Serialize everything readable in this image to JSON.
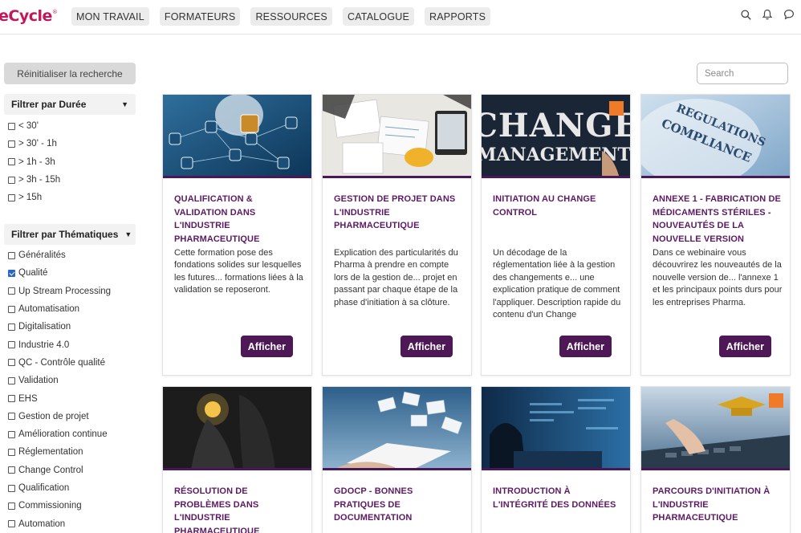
{
  "header": {
    "logo": "eCycle",
    "logo_mark": "®",
    "nav": [
      "MON TRAVAIL",
      "FORMATEURS",
      "RESSOURCES",
      "CATALOGUE",
      "RAPPORTS"
    ],
    "icons": [
      "search-icon",
      "bell-icon",
      "chat-icon"
    ]
  },
  "sidebar": {
    "reset_label": "Réinitialiser la recherche",
    "duration": {
      "title": "Filtrer par Durée",
      "options": [
        {
          "label": "< 30'",
          "checked": false
        },
        {
          "label": "> 30' - 1h",
          "checked": false
        },
        {
          "label": "> 1h - 3h",
          "checked": false
        },
        {
          "label": "> 3h - 15h",
          "checked": false
        },
        {
          "label": "> 15h",
          "checked": false
        }
      ]
    },
    "theme": {
      "title": "Filtrer par Thématiques",
      "options": [
        {
          "label": "Généralités",
          "checked": false
        },
        {
          "label": "Qualité",
          "checked": true
        },
        {
          "label": "Up Stream Processing",
          "checked": false
        },
        {
          "label": "Automatisation",
          "checked": false
        },
        {
          "label": "Digitalisation",
          "checked": false
        },
        {
          "label": "Industrie 4.0",
          "checked": false
        },
        {
          "label": "QC - Contrôle qualité",
          "checked": false
        },
        {
          "label": "Validation",
          "checked": false
        },
        {
          "label": "EHS",
          "checked": false
        },
        {
          "label": "Gestion de projet",
          "checked": false
        },
        {
          "label": "Amélioration continue",
          "checked": false
        },
        {
          "label": "Réglementation",
          "checked": false
        },
        {
          "label": "Change Control",
          "checked": false
        },
        {
          "label": "Qualification",
          "checked": false
        },
        {
          "label": "Commissioning",
          "checked": false
        },
        {
          "label": "Automation",
          "checked": false
        }
      ]
    }
  },
  "search": {
    "placeholder": "Search"
  },
  "cards": [
    {
      "title": "QUALIFICATION & VALIDATION DANS L'INDUSTRIE PHARMACEUTIQUE",
      "desc": "Cette formation pose des fondations solides sur lesquelles les futures... formations liées à la validation se reposeront.",
      "button": "Afficher",
      "thumb_text": ""
    },
    {
      "title": "GESTION DE PROJET DANS L'INDUSTRIE PHARMACEUTIQUE",
      "desc": "Explication des particularités du Pharma à prendre en compte lors de la gestion de... projet en passant par chaque étape de la phase d'initiation à sa clôture.",
      "button": "Afficher",
      "thumb_text": ""
    },
    {
      "title": "INITIATION AU CHANGE CONTROL",
      "desc": "Un décodage de la réglementation liée à la gestion des changements e... une explication pratique de comment l'appliquer. Description rapide du contenu d'un Change",
      "button": "Afficher",
      "thumb_text": "CHANGE MANAGEMENT"
    },
    {
      "title": "ANNEXE 1 - FABRICATION DE MÉDICAMENTS STÉRILES - NOUVEAUTÉS DE LA NOUVELLE VERSION",
      "desc": "Dans ce webinaire vous découvrirez les nouveautés de la nouvelle version de... l'annexe 1 et les principaux points durs pour les entreprises Pharma.",
      "button": "Afficher",
      "thumb_text": "REGULATIONS COMPLIANCE"
    },
    {
      "title": "RÉSOLUTION DE PROBLÈMES DANS L'INDUSTRIE PHARMACEUTIQUE",
      "desc": "",
      "button": "",
      "thumb_text": ""
    },
    {
      "title": "GDOCP - BONNES PRATIQUES DE DOCUMENTATION",
      "desc": "",
      "button": "",
      "thumb_text": ""
    },
    {
      "title": "INTRODUCTION À L'INTÉGRITÉ DES DONNÉES",
      "desc": "",
      "button": "",
      "thumb_text": ""
    },
    {
      "title": "PARCOURS D'INITIATION À L'INDUSTRIE PHARMACEUTIQUE",
      "desc": "",
      "button": "",
      "thumb_text": ""
    }
  ],
  "colors": {
    "brand": "#c0185b",
    "accent": "#4e1755",
    "title": "#5c1a63",
    "badge": "#ef7a2a",
    "checkbox": "#2a66c6"
  }
}
